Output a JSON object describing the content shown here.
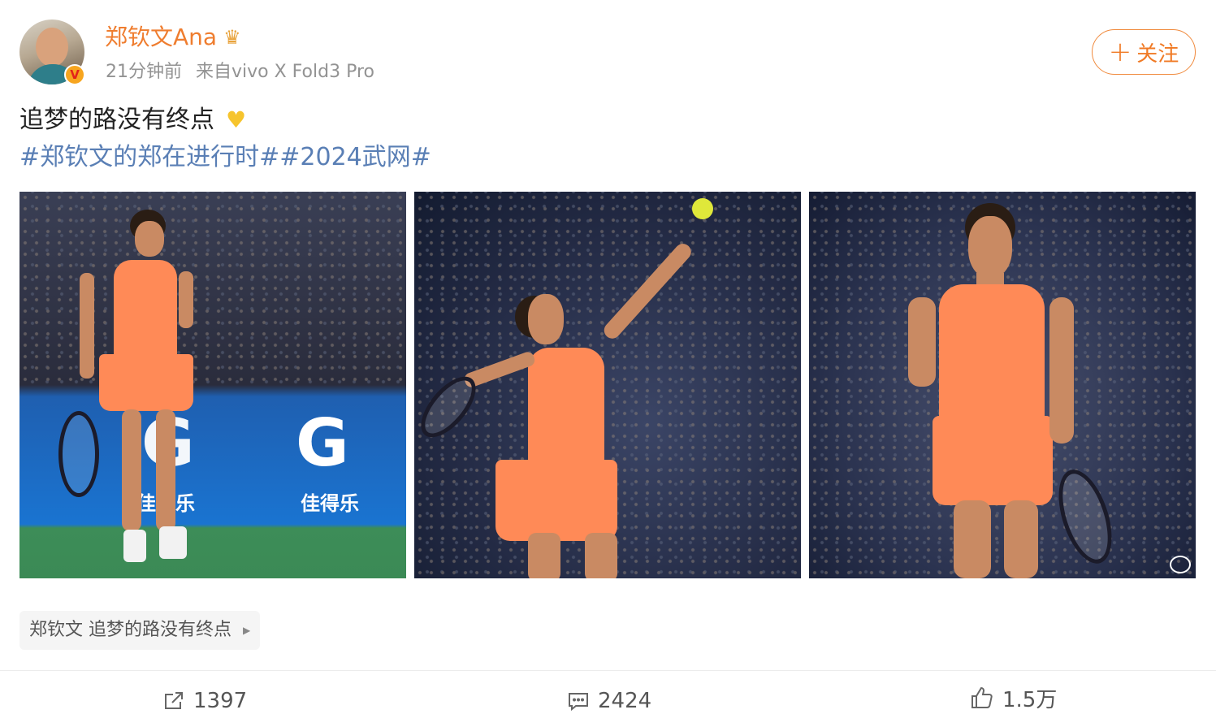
{
  "post": {
    "username": "郑钦文Ana",
    "crown_icon": "crown-icon",
    "time": "21分钟前",
    "source": "来自vivo X Fold3 Pro",
    "follow_label": "关注",
    "text": "追梦的路没有终点",
    "emoji": "yellow-heart-icon",
    "hashtags": [
      "#郑钦文的郑在进行时#",
      "#2024武网#"
    ],
    "photos": [
      {
        "ad_logo": "G",
        "ad_text": "佳得乐"
      },
      {},
      {}
    ],
    "source_card": {
      "label": "郑钦文 追梦的路没有终点"
    },
    "actions": {
      "share_count": "1397",
      "comment_count": "2424",
      "like_count": "1.5万"
    }
  },
  "colors": {
    "username": "#ef7d2f",
    "hashtag": "#5a7fb5",
    "follow_border": "#f08a3d",
    "verified_badge": "#f7a51f"
  }
}
